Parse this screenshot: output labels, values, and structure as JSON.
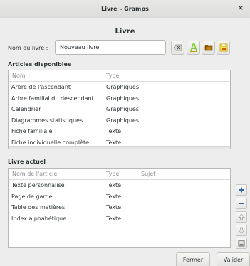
{
  "window": {
    "title": "Livre – Gramps",
    "close_glyph": "×"
  },
  "heading": "Livre",
  "book_name": {
    "label": "Nom du livre :",
    "value": "Nouveau livre"
  },
  "toolbar": {
    "icons": [
      "clear-icon",
      "edit-icon",
      "open-icon",
      "save-icon"
    ]
  },
  "available": {
    "label": "Articles disponibles",
    "columns": [
      "Nom",
      "Type"
    ],
    "rows": [
      [
        "Arbre de l'ascendant",
        "Graphiques"
      ],
      [
        "Arbre familial du descendant",
        "Graphiques"
      ],
      [
        "Calendrier",
        "Graphiques"
      ],
      [
        "Diagrammes statistiques",
        "Graphiques"
      ],
      [
        "Fiche familiale",
        "Texte"
      ],
      [
        "Fiche individuelle complète",
        "Texte"
      ]
    ]
  },
  "current": {
    "label": "Livre actuel",
    "columns": [
      "Nom de l'article",
      "Type",
      "Sujet"
    ],
    "rows": [
      [
        "Texte personnalisé",
        "Texte",
        ""
      ],
      [
        "Page de garde",
        "Texte",
        ""
      ],
      [
        "Table des matières",
        "Texte",
        ""
      ],
      [
        "Index alphabétique",
        "Texte",
        ""
      ]
    ]
  },
  "side_buttons": [
    "add-icon",
    "remove-icon",
    "move-up-icon",
    "move-down-icon",
    "configure-icon"
  ],
  "buttons": {
    "close": "Fermer",
    "validate": "Valider"
  },
  "colors": {
    "add": "#3465a4",
    "remove": "#3465a4",
    "disabled": "#a8a8a4"
  }
}
